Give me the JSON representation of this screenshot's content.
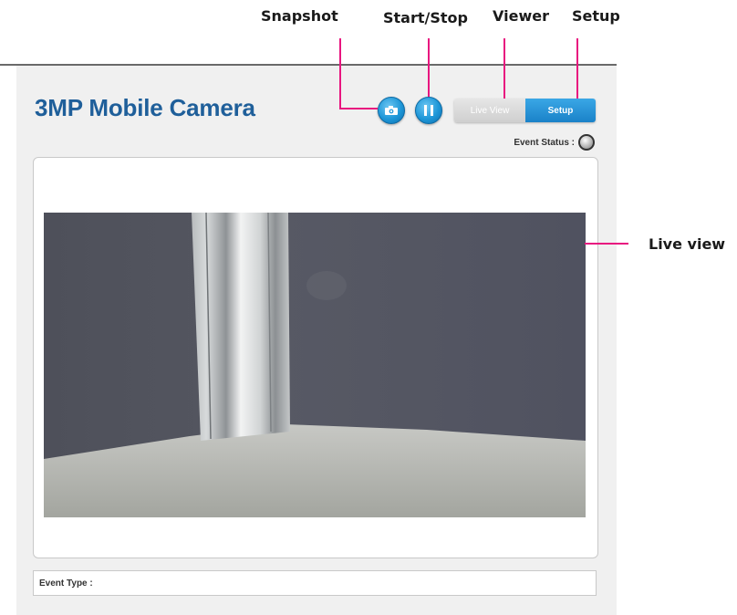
{
  "callouts": {
    "snapshot": "Snapshot",
    "start_stop": "Start/Stop",
    "viewer": "Viewer",
    "setup": "Setup",
    "live_view": "Live view"
  },
  "app": {
    "title": "3MP Mobile Camera",
    "accent_color": "#1f5f9a",
    "button_color": "#1e97d8"
  },
  "toolbar": {
    "snapshot_icon": "camera-icon",
    "start_stop_icon": "pause-icon",
    "view_toggle": {
      "live_view_label": "Live View",
      "setup_label": "Setup",
      "selected": "Setup"
    }
  },
  "event_status": {
    "label": "Event Status :"
  },
  "event_type": {
    "label": "Event Type :"
  }
}
